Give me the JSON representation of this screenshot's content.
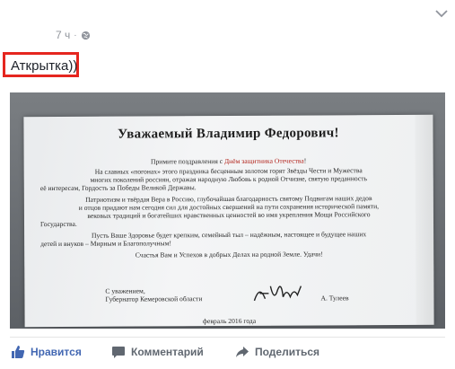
{
  "post": {
    "time": "7 ч",
    "separator": "·",
    "caption": "Аткрытка))"
  },
  "letter": {
    "title": "Уважаемый Владимир Федорович!",
    "greeting_prefix": "Примите поздравления с ",
    "greeting_red": "Днём защитника Отечества",
    "greeting_suffix": "!",
    "p1_line1": "На славных «погонах» этого праздника бесценным золотом горят Звёзды Чести и Мужества",
    "p1_line2": "многих поколений россиян, отражая народную Любовь к родной Отчизне, святую преданность",
    "p1_line3": "её интересам, Гордость за Победы Великой Державы.",
    "p2_line1": "Патриотизм и твёрдая Вера в Россию, глубочайшая благодарность святому Подвигам наших дедов",
    "p2_line2": "и отцов придают нам сегодня сил для достойных свершений на пути сохранения исторической памяти,",
    "p2_line3": "вековых традиций и богатейших нравственных ценностей во имя укрепления Мощи Российского",
    "p2_line4": "Государства.",
    "p3_line1": "Пусть Ваше Здоровье будет крепким, семейный тыл – надёжным, настоящее и будущее наших",
    "p3_line2": "детей и внуков – Мирным и Благополучным!",
    "p4_line1": "Счастья Вам и Успехов в добрых Делах на родной Земле. Удачи!",
    "sign_line1": "С уважением,",
    "sign_line2": "Губернатор Кемеровской области",
    "sign_name": "А. Тулеев",
    "date": "февраль 2016 года"
  },
  "actions": {
    "like": "Нравится",
    "comment": "Комментарий",
    "share": "Поделиться"
  },
  "colors": {
    "highlight_border": "#e5261f",
    "like_blue": "#4267b2",
    "muted": "#90949c"
  }
}
